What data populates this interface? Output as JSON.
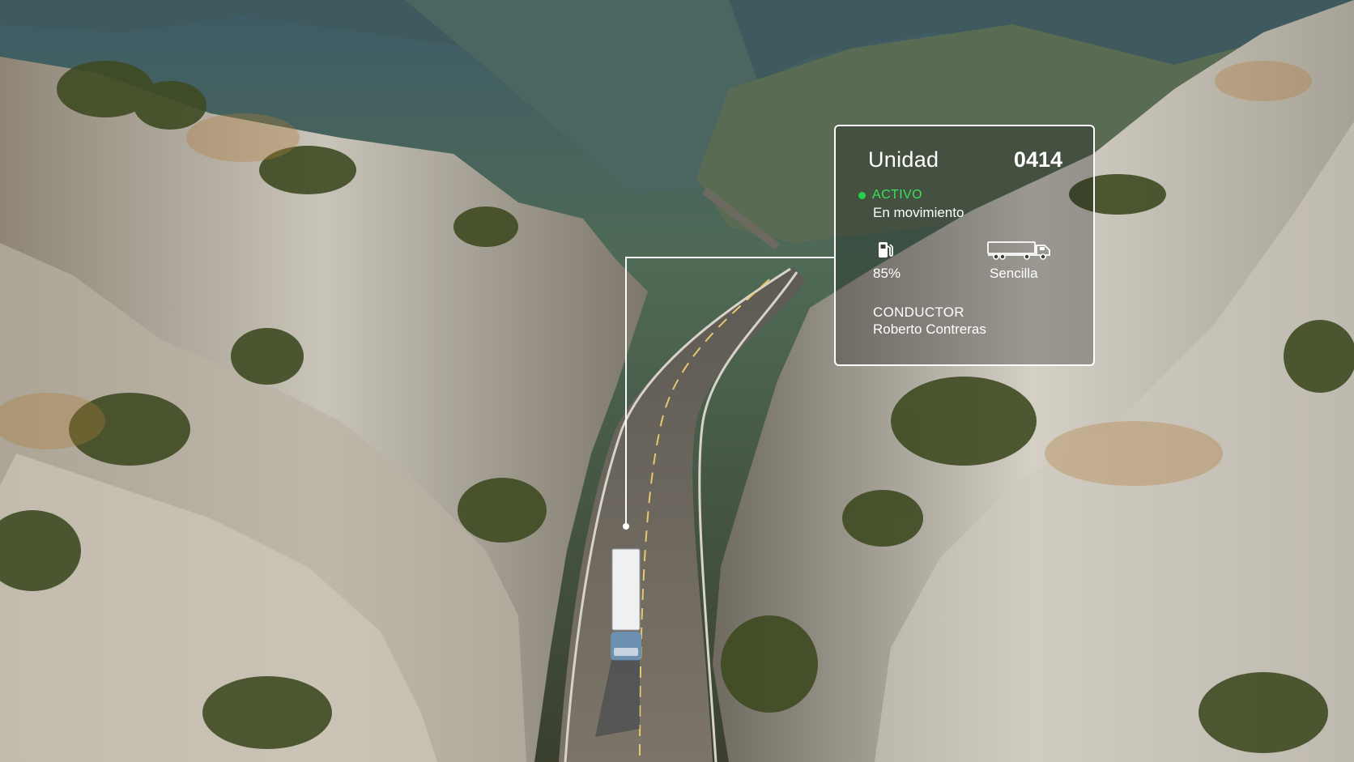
{
  "card": {
    "unit_label": "Unidad",
    "unit_number": "0414",
    "status": "ACTIVO",
    "status_color": "#27d04a",
    "movement": "En movimiento",
    "fuel_icon": "fuel-pump-icon",
    "fuel_value": "85%",
    "truck_icon": "semi-truck-icon",
    "trailer_type": "Sencilla",
    "driver_label": "CONDUCTOR",
    "driver_name": "Roberto Contreras"
  }
}
